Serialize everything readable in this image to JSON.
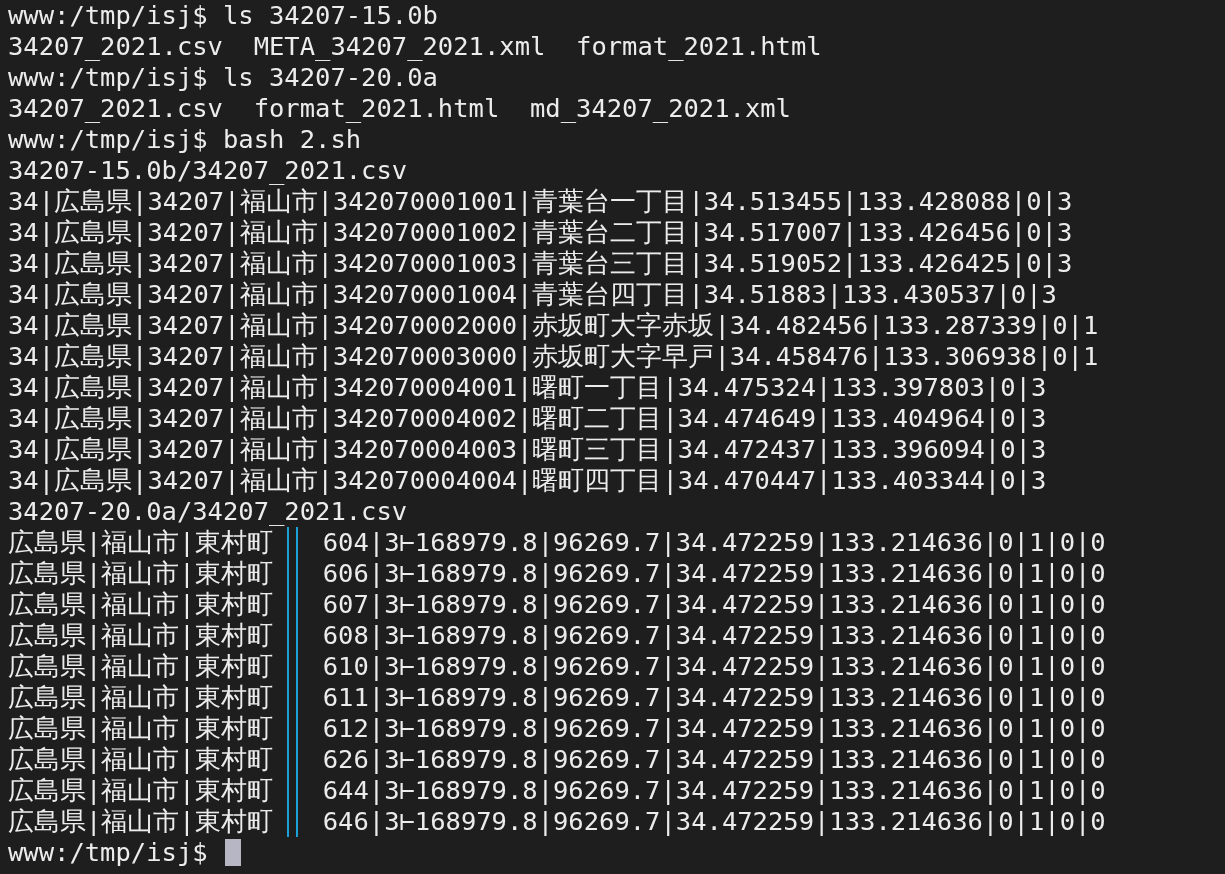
{
  "terminal": {
    "lines": [
      {
        "kind": "text",
        "text": "www:/tmp/isj$ ls 34207-15.0b"
      },
      {
        "kind": "text",
        "text": "34207_2021.csv  META_34207_2021.xml  format_2021.html"
      },
      {
        "kind": "text",
        "text": "www:/tmp/isj$ ls 34207-20.0a"
      },
      {
        "kind": "text",
        "text": "34207_2021.csv  format_2021.html  md_34207_2021.xml"
      },
      {
        "kind": "text",
        "text": "www:/tmp/isj$ bash 2.sh"
      },
      {
        "kind": "text",
        "text": "34207-15.0b/34207_2021.csv"
      },
      {
        "kind": "text",
        "text": "34|広島県|34207|福山市|342070001001|青葉台一丁目|34.513455|133.428088|0|3"
      },
      {
        "kind": "text",
        "text": "34|広島県|34207|福山市|342070001002|青葉台二丁目|34.517007|133.426456|0|3"
      },
      {
        "kind": "text",
        "text": "34|広島県|34207|福山市|342070001003|青葉台三丁目|34.519052|133.426425|0|3"
      },
      {
        "kind": "text",
        "text": "34|広島県|34207|福山市|342070001004|青葉台四丁目|34.51883|133.430537|0|3"
      },
      {
        "kind": "text",
        "text": "34|広島県|34207|福山市|342070002000|赤坂町大字赤坂|34.482456|133.287339|0|1"
      },
      {
        "kind": "text",
        "text": "34|広島県|34207|福山市|342070003000|赤坂町大字早戸|34.458476|133.306938|0|1"
      },
      {
        "kind": "text",
        "text": "34|広島県|34207|福山市|342070004001|曙町一丁目|34.475324|133.397803|0|3"
      },
      {
        "kind": "text",
        "text": "34|広島県|34207|福山市|342070004002|曙町二丁目|34.474649|133.404964|0|3"
      },
      {
        "kind": "text",
        "text": "34|広島県|34207|福山市|342070004003|曙町三丁目|34.472437|133.396094|0|3"
      },
      {
        "kind": "text",
        "text": "34|広島県|34207|福山市|342070004004|曙町四丁目|34.470447|133.403344|0|3"
      },
      {
        "kind": "text",
        "text": "34207-20.0a/34207_2021.csv"
      },
      {
        "kind": "split",
        "left": "広島県|福山市|東村町",
        "right": "604|3⊢168979.8|96269.7|34.472259|133.214636|0|1|0|0"
      },
      {
        "kind": "split",
        "left": "広島県|福山市|東村町",
        "right": "606|3⊢168979.8|96269.7|34.472259|133.214636|0|1|0|0"
      },
      {
        "kind": "split",
        "left": "広島県|福山市|東村町",
        "right": "607|3⊢168979.8|96269.7|34.472259|133.214636|0|1|0|0"
      },
      {
        "kind": "split",
        "left": "広島県|福山市|東村町",
        "right": "608|3⊢168979.8|96269.7|34.472259|133.214636|0|1|0|0"
      },
      {
        "kind": "split",
        "left": "広島県|福山市|東村町",
        "right": "610|3⊢168979.8|96269.7|34.472259|133.214636|0|1|0|0"
      },
      {
        "kind": "split",
        "left": "広島県|福山市|東村町",
        "right": "611|3⊢168979.8|96269.7|34.472259|133.214636|0|1|0|0"
      },
      {
        "kind": "split",
        "left": "広島県|福山市|東村町",
        "right": "612|3⊢168979.8|96269.7|34.472259|133.214636|0|1|0|0"
      },
      {
        "kind": "split",
        "left": "広島県|福山市|東村町",
        "right": "626|3⊢168979.8|96269.7|34.472259|133.214636|0|1|0|0"
      },
      {
        "kind": "split",
        "left": "広島県|福山市|東村町",
        "right": "644|3⊢168979.8|96269.7|34.472259|133.214636|0|1|0|0"
      },
      {
        "kind": "split",
        "left": "広島県|福山市|東村町",
        "right": "646|3⊢168979.8|96269.7|34.472259|133.214636|0|1|0|0"
      },
      {
        "kind": "prompt",
        "text": "www:/tmp/isj$"
      }
    ]
  }
}
